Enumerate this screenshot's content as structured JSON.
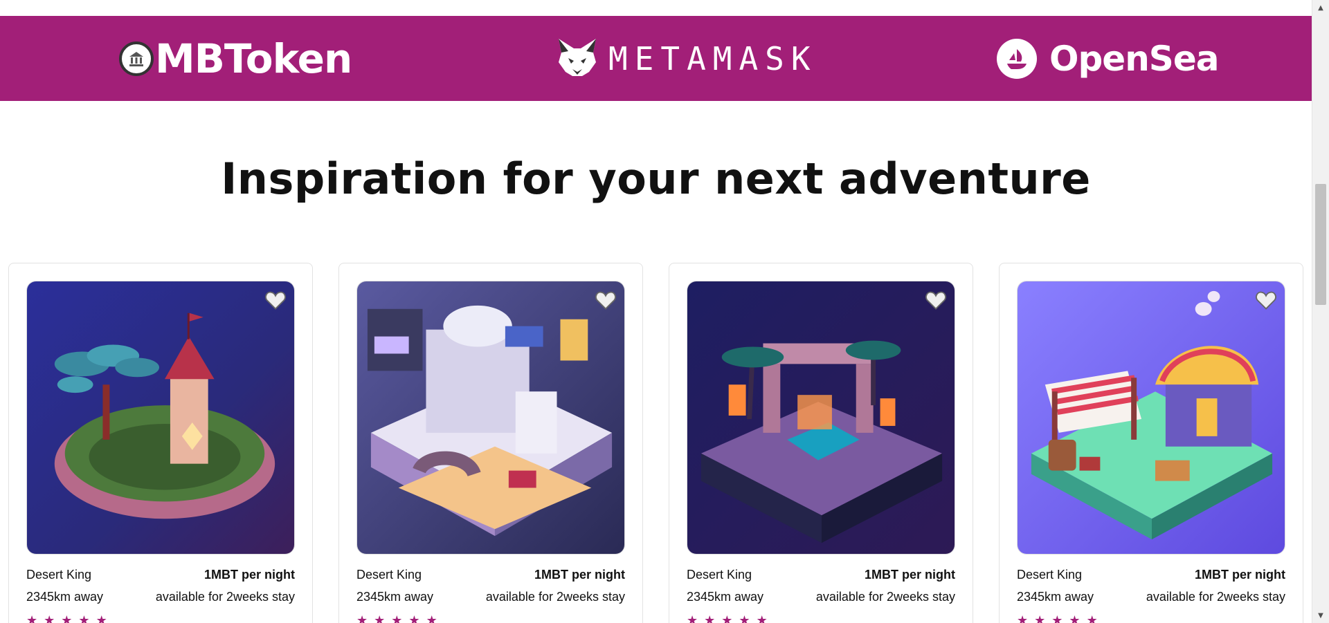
{
  "brands": {
    "mbtoken": {
      "name": "MBToken",
      "icon": "coin-icon"
    },
    "metamask": {
      "name": "METAMASK",
      "icon": "fox-icon"
    },
    "opensea": {
      "name": "OpenSea",
      "icon": "ship-icon"
    }
  },
  "colors": {
    "brand_bar": "#a21f78",
    "star": "#a21f78"
  },
  "section": {
    "title": "Inspiration for your next adventure"
  },
  "cards": [
    {
      "name": "Desert King",
      "price": "1MBT per night",
      "distance": "2345km away",
      "availability": "available for 2weeks stay",
      "stars": [
        "★",
        "★",
        "★",
        "★",
        "★"
      ]
    },
    {
      "name": "Desert King",
      "price": "1MBT per night",
      "distance": "2345km away",
      "availability": "available for 2weeks stay",
      "stars": [
        "★",
        "★",
        "★",
        "★",
        "★"
      ]
    },
    {
      "name": "Desert King",
      "price": "1MBT per night",
      "distance": "2345km away",
      "availability": "available for 2weeks stay",
      "stars": [
        "★",
        "★",
        "★",
        "★",
        "★"
      ]
    },
    {
      "name": "Desert King",
      "price": "1MBT per night",
      "distance": "2345km away",
      "availability": "available for 2weeks stay",
      "stars": [
        "★",
        "★",
        "★",
        "★",
        "★"
      ]
    }
  ],
  "scrollbar": {
    "up": "▲",
    "down": "▼"
  }
}
